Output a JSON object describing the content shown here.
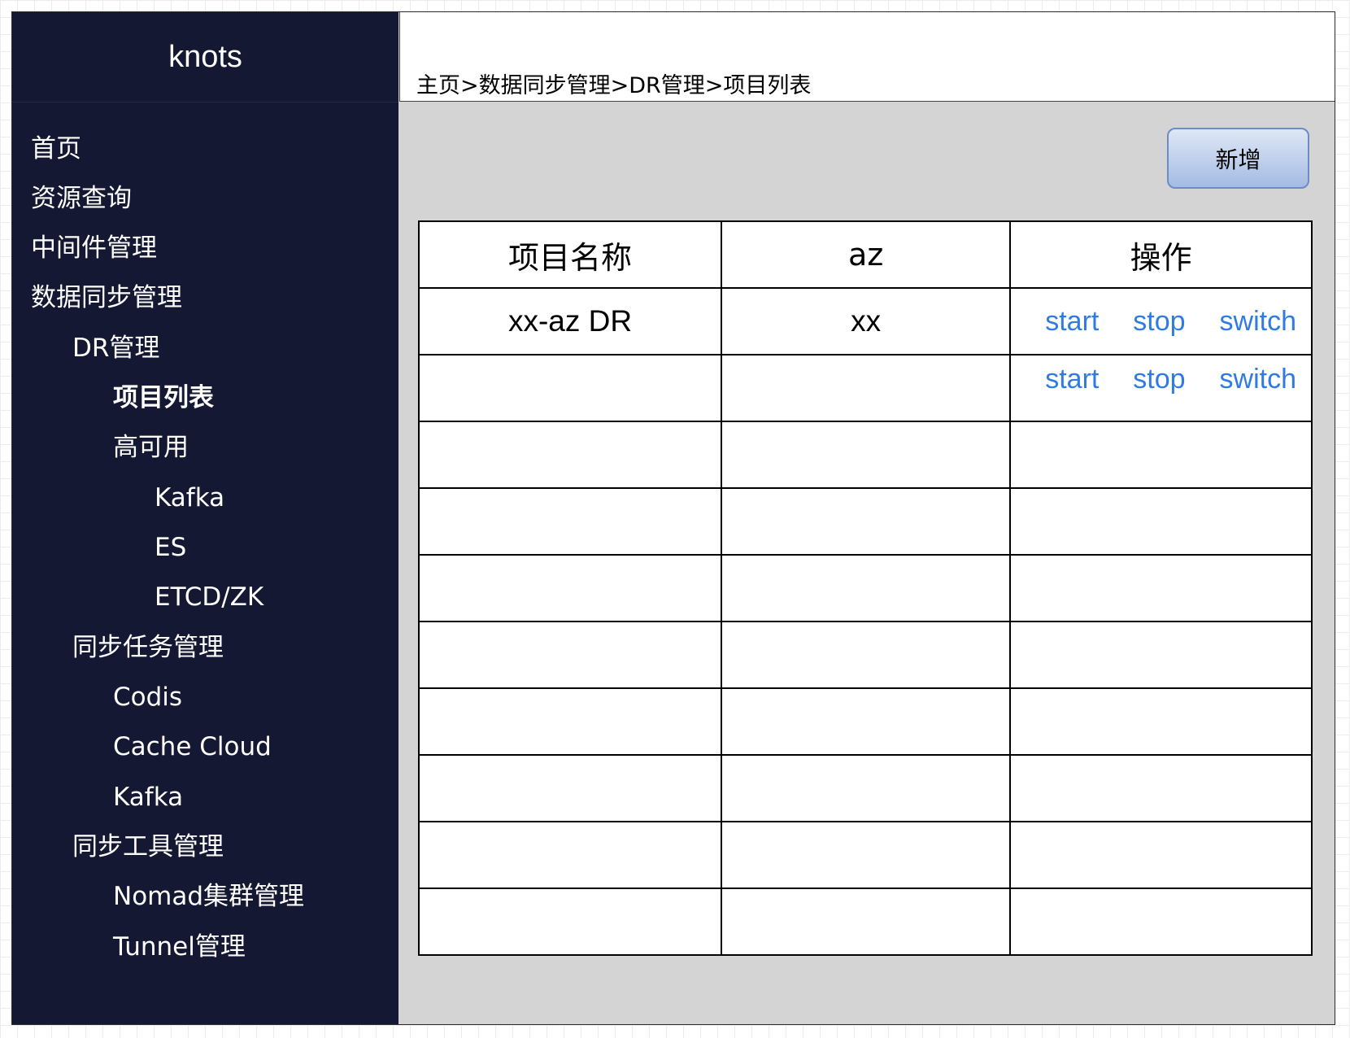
{
  "app": {
    "title": "knots"
  },
  "breadcrumb": "主页>数据同步管理>DR管理>项目列表",
  "sidebar": {
    "items": [
      {
        "label": "首页"
      },
      {
        "label": "资源查询"
      },
      {
        "label": "中间件管理"
      },
      {
        "label": "数据同步管理"
      },
      {
        "label": "DR管理"
      },
      {
        "label": "项目列表",
        "active": true
      },
      {
        "label": "高可用"
      },
      {
        "label": "Kafka"
      },
      {
        "label": "ES"
      },
      {
        "label": "ETCD/ZK"
      },
      {
        "label": "同步任务管理"
      },
      {
        "label": "Codis"
      },
      {
        "label": "Cache Cloud"
      },
      {
        "label": "Kafka"
      },
      {
        "label": "同步工具管理"
      },
      {
        "label": "Nomad集群管理"
      },
      {
        "label": "Tunnel管理"
      }
    ]
  },
  "toolbar": {
    "add_label": "新增"
  },
  "table": {
    "headers": [
      "项目名称",
      "az",
      "操作"
    ],
    "rows": [
      {
        "name": "xx-az DR",
        "az": "xx",
        "actions": [
          "start",
          "stop",
          "switch"
        ]
      },
      {
        "name": "",
        "az": "",
        "actions": [
          "start",
          "stop",
          "switch"
        ]
      },
      {
        "name": "",
        "az": "",
        "actions": []
      },
      {
        "name": "",
        "az": "",
        "actions": []
      },
      {
        "name": "",
        "az": "",
        "actions": []
      },
      {
        "name": "",
        "az": "",
        "actions": []
      },
      {
        "name": "",
        "az": "",
        "actions": []
      },
      {
        "name": "",
        "az": "",
        "actions": []
      },
      {
        "name": "",
        "az": "",
        "actions": []
      },
      {
        "name": "",
        "az": "",
        "actions": []
      }
    ]
  },
  "colors": {
    "sidebar_bg": "#151832",
    "content_bg": "#d4d4d4",
    "link": "#2f7be3",
    "button_border": "#6c8cc6"
  }
}
